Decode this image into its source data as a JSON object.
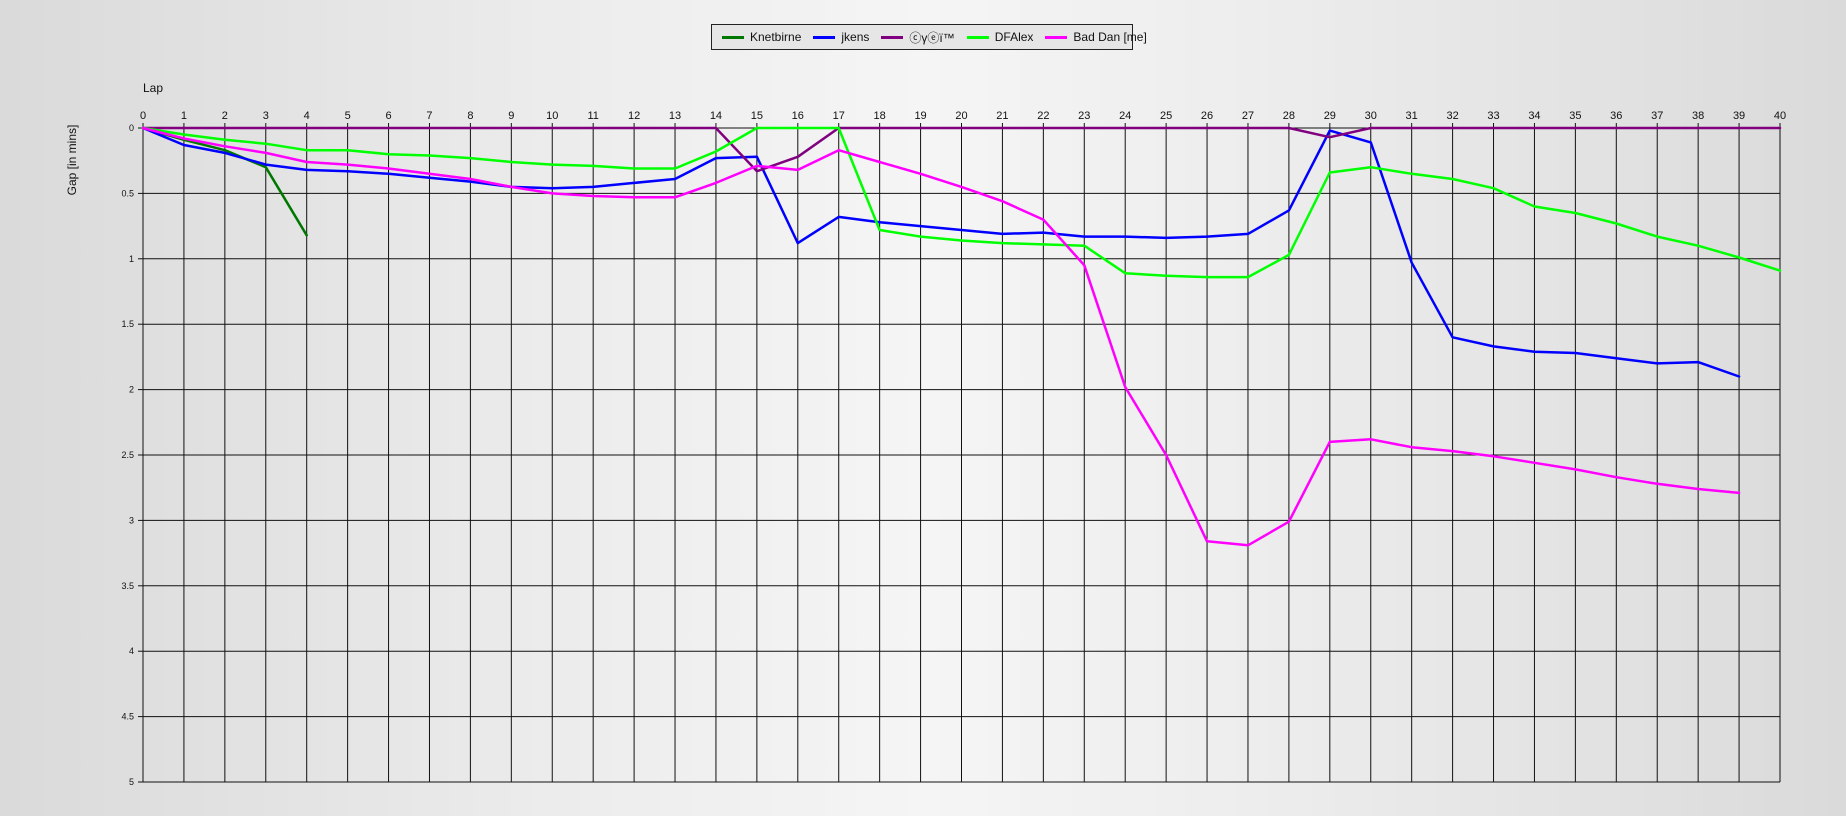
{
  "chart_data": {
    "type": "line",
    "xlabel": "Lap",
    "ylabel": "Gap [in mins]",
    "xlim": [
      0,
      40
    ],
    "ylim": [
      0,
      5
    ],
    "y_inverted": true,
    "grid": true,
    "legend_position": "top-center",
    "x_ticks": [
      "0",
      "1",
      "2",
      "3",
      "4",
      "5",
      "6",
      "7",
      "8",
      "9",
      "10",
      "11",
      "12",
      "13",
      "14",
      "15",
      "16",
      "17",
      "18",
      "19",
      "20",
      "21",
      "22",
      "23",
      "24",
      "25",
      "26",
      "27",
      "28",
      "29",
      "30",
      "31",
      "32",
      "33",
      "34",
      "35",
      "36",
      "37",
      "38",
      "39",
      "40"
    ],
    "y_ticks": [
      "0",
      "0.5",
      "1",
      "1.5",
      "2",
      "2.5",
      "3",
      "3.5",
      "4",
      "4.5",
      "5"
    ],
    "series": [
      {
        "name": "Knetbirne",
        "color": "#007800",
        "x": [
          0,
          1,
          2,
          3,
          4
        ],
        "y": [
          0,
          0.09,
          0.17,
          0.3,
          0.82
        ]
      },
      {
        "name": "jkens",
        "color": "#0000ff",
        "x": [
          0,
          1,
          2,
          3,
          4,
          5,
          6,
          7,
          8,
          9,
          10,
          11,
          12,
          13,
          14,
          15,
          16,
          17,
          18,
          19,
          20,
          21,
          22,
          23,
          24,
          25,
          26,
          27,
          28,
          29,
          30,
          31,
          32,
          33,
          34,
          35,
          36,
          37,
          38,
          39
        ],
        "y": [
          0,
          0.13,
          0.19,
          0.28,
          0.32,
          0.33,
          0.35,
          0.38,
          0.41,
          0.45,
          0.46,
          0.45,
          0.42,
          0.39,
          0.23,
          0.22,
          0.88,
          0.68,
          0.72,
          0.75,
          0.78,
          0.81,
          0.8,
          0.83,
          0.83,
          0.84,
          0.83,
          0.81,
          0.63,
          0.02,
          0.11,
          1.03,
          1.6,
          1.67,
          1.71,
          1.72,
          1.76,
          1.8,
          1.79,
          1.9
        ]
      },
      {
        "name": "ⓒγⓔï™",
        "color": "#800080",
        "x": [
          0,
          14,
          15,
          16,
          17,
          28,
          29,
          30,
          40
        ],
        "y": [
          0,
          0,
          0.33,
          0.22,
          0,
          0,
          0.07,
          0,
          0
        ]
      },
      {
        "name": "DFAlex",
        "color": "#00ff00",
        "x": [
          0,
          1,
          2,
          3,
          4,
          5,
          6,
          7,
          8,
          9,
          10,
          11,
          12,
          13,
          14,
          15,
          16,
          17,
          18,
          19,
          20,
          21,
          22,
          23,
          24,
          25,
          26,
          27,
          28,
          29,
          30,
          31,
          32,
          33,
          34,
          35,
          36,
          37,
          38,
          39,
          40
        ],
        "y": [
          0,
          0.05,
          0.09,
          0.12,
          0.17,
          0.17,
          0.2,
          0.21,
          0.23,
          0.26,
          0.28,
          0.29,
          0.31,
          0.31,
          0.18,
          0,
          0,
          0,
          0.78,
          0.83,
          0.86,
          0.88,
          0.89,
          0.9,
          1.11,
          1.13,
          1.14,
          1.14,
          0.97,
          0.34,
          0.3,
          0.35,
          0.39,
          0.46,
          0.6,
          0.65,
          0.73,
          0.83,
          0.9,
          0.99,
          1.09
        ]
      },
      {
        "name": "Bad Dan [me]",
        "color": "#ff00ff",
        "x": [
          0,
          1,
          2,
          3,
          4,
          5,
          6,
          7,
          8,
          9,
          10,
          11,
          12,
          13,
          14,
          15,
          16,
          17,
          18,
          19,
          20,
          21,
          22,
          23,
          24,
          25,
          26,
          27,
          28,
          29,
          30,
          31,
          32,
          33,
          34,
          35,
          36,
          37,
          38,
          39
        ],
        "y": [
          0,
          0.08,
          0.14,
          0.19,
          0.26,
          0.28,
          0.31,
          0.35,
          0.39,
          0.45,
          0.5,
          0.52,
          0.53,
          0.53,
          0.42,
          0.29,
          0.32,
          0.17,
          0.26,
          0.35,
          0.45,
          0.56,
          0.7,
          1.05,
          1.98,
          2.5,
          3.16,
          3.19,
          3.01,
          2.4,
          2.38,
          2.44,
          2.47,
          2.51,
          2.56,
          2.61,
          2.67,
          2.72,
          2.76,
          2.79
        ]
      }
    ]
  }
}
